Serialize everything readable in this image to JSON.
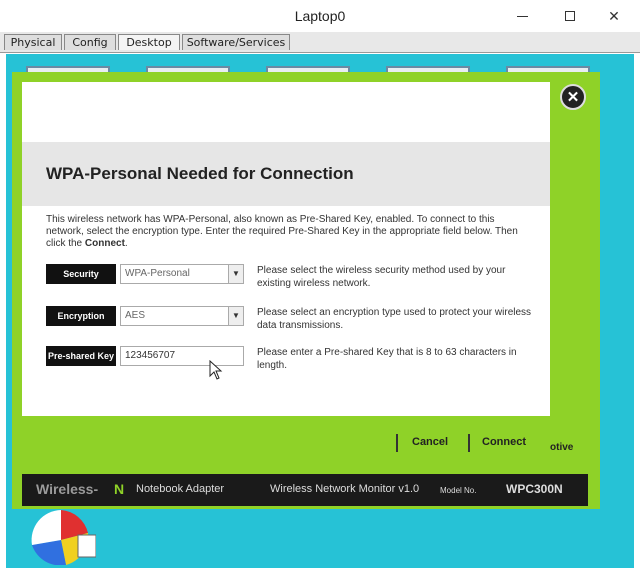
{
  "window": {
    "title": "Laptop0"
  },
  "tabs": [
    {
      "label": "Physical"
    },
    {
      "label": "Config"
    },
    {
      "label": "Desktop"
    },
    {
      "label": "Software/Services"
    }
  ],
  "dialog": {
    "heading": "WPA-Personal Needed for Connection",
    "description_part1": "This wireless network has WPA-Personal, also known as Pre-Shared Key, enabled. To connect to this network, select the encryption type. Enter the required Pre-Shared Key in the appropriate field below. Then click the ",
    "description_bold": "Connect",
    "description_end": ".",
    "rows": {
      "security": {
        "label": "Security",
        "value": "WPA-Personal",
        "help": "Please select the wireless security method used by your existing wireless network."
      },
      "encryption": {
        "label": "Encryption",
        "value": "AES",
        "help": "Please select an encryption type used to protect your wireless data transmissions."
      },
      "psk": {
        "label": "Pre-shared Key",
        "value": "123456707",
        "help": "Please enter a Pre-shared Key that is 8 to 63 characters in length."
      }
    },
    "cancel_label": "Cancel",
    "connect_label": "Connect",
    "partial_text": "otive"
  },
  "footer": {
    "brand": "Wireless-",
    "brand_n": "N",
    "product": "Notebook Adapter",
    "monitor": "Wireless Network Monitor  v1.0",
    "model_label": "Model No.",
    "model": "WPC300N"
  },
  "colors": {
    "accent_green": "#8fd228",
    "desktop_cyan": "#26c2d6"
  },
  "icons": {
    "close": "close-icon",
    "dropdown": "chevron-down-icon",
    "cursor": "mouse-pointer-icon"
  }
}
